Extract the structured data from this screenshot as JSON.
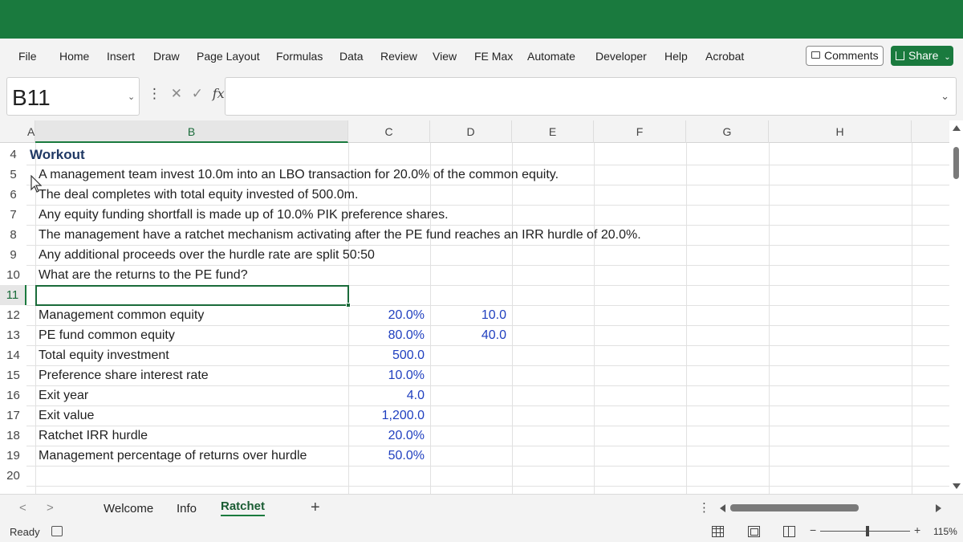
{
  "ribbon": {
    "tabs": [
      "File",
      "Home",
      "Insert",
      "Draw",
      "Page Layout",
      "Formulas",
      "Data",
      "Review",
      "View",
      "FE Max",
      "Automate",
      "Developer",
      "Help",
      "Acrobat"
    ],
    "comments_label": "Comments",
    "share_label": "Share",
    "accent_color": "#1a7a3e"
  },
  "formula_bar": {
    "name_box": "B11",
    "formula": "",
    "cancel_glyph": "✕",
    "enter_glyph": "✓",
    "fx_label": "fx"
  },
  "columns": [
    "A",
    "B",
    "C",
    "D",
    "E",
    "F",
    "G",
    "H"
  ],
  "rows": [
    "4",
    "5",
    "6",
    "7",
    "8",
    "9",
    "10",
    "11",
    "12",
    "13",
    "14",
    "15",
    "16",
    "17",
    "18",
    "19",
    "20"
  ],
  "sheet": {
    "title": "Workout",
    "lines": [
      "A management team invest 10.0m into an LBO transaction for 20.0% of the common equity.",
      "The deal completes with total equity invested of 500.0m.",
      "Any equity funding shortfall is made up of 10.0% PIK preference shares.",
      "The management have a ratchet mechanism activating after the PE fund reaches an IRR hurdle of 20.0%.",
      "Any additional proceeds over the hurdle rate are split 50:50",
      "What are the returns to the PE fund?"
    ],
    "inputs": [
      {
        "label": "Management common equity",
        "value": "20.0%",
        "extra": "10.0"
      },
      {
        "label": "PE fund common equity",
        "value": "80.0%",
        "extra": "40.0"
      },
      {
        "label": "Total equity investment",
        "value": "500.0",
        "extra": ""
      },
      {
        "label": "Preference share interest rate",
        "value": "10.0%",
        "extra": ""
      },
      {
        "label": "Exit year",
        "value": "4.0",
        "extra": ""
      },
      {
        "label": "Exit value",
        "value": "1,200.0",
        "extra": ""
      },
      {
        "label": "Ratchet IRR hurdle",
        "value": "20.0%",
        "extra": ""
      },
      {
        "label": "Management percentage of returns over hurdle",
        "value": "50.0%",
        "extra": ""
      }
    ]
  },
  "sheet_tabs": {
    "tabs": [
      "Welcome",
      "Info",
      "Ratchet"
    ],
    "active": "Ratchet",
    "add_glyph": "+",
    "prev_glyph": "<",
    "next_glyph": ">",
    "more_glyph": "⋮"
  },
  "status": {
    "ready": "Ready",
    "zoom": "115%",
    "zoom_fraction": 0.15,
    "minus_glyph": "−",
    "plus_glyph": "+"
  }
}
